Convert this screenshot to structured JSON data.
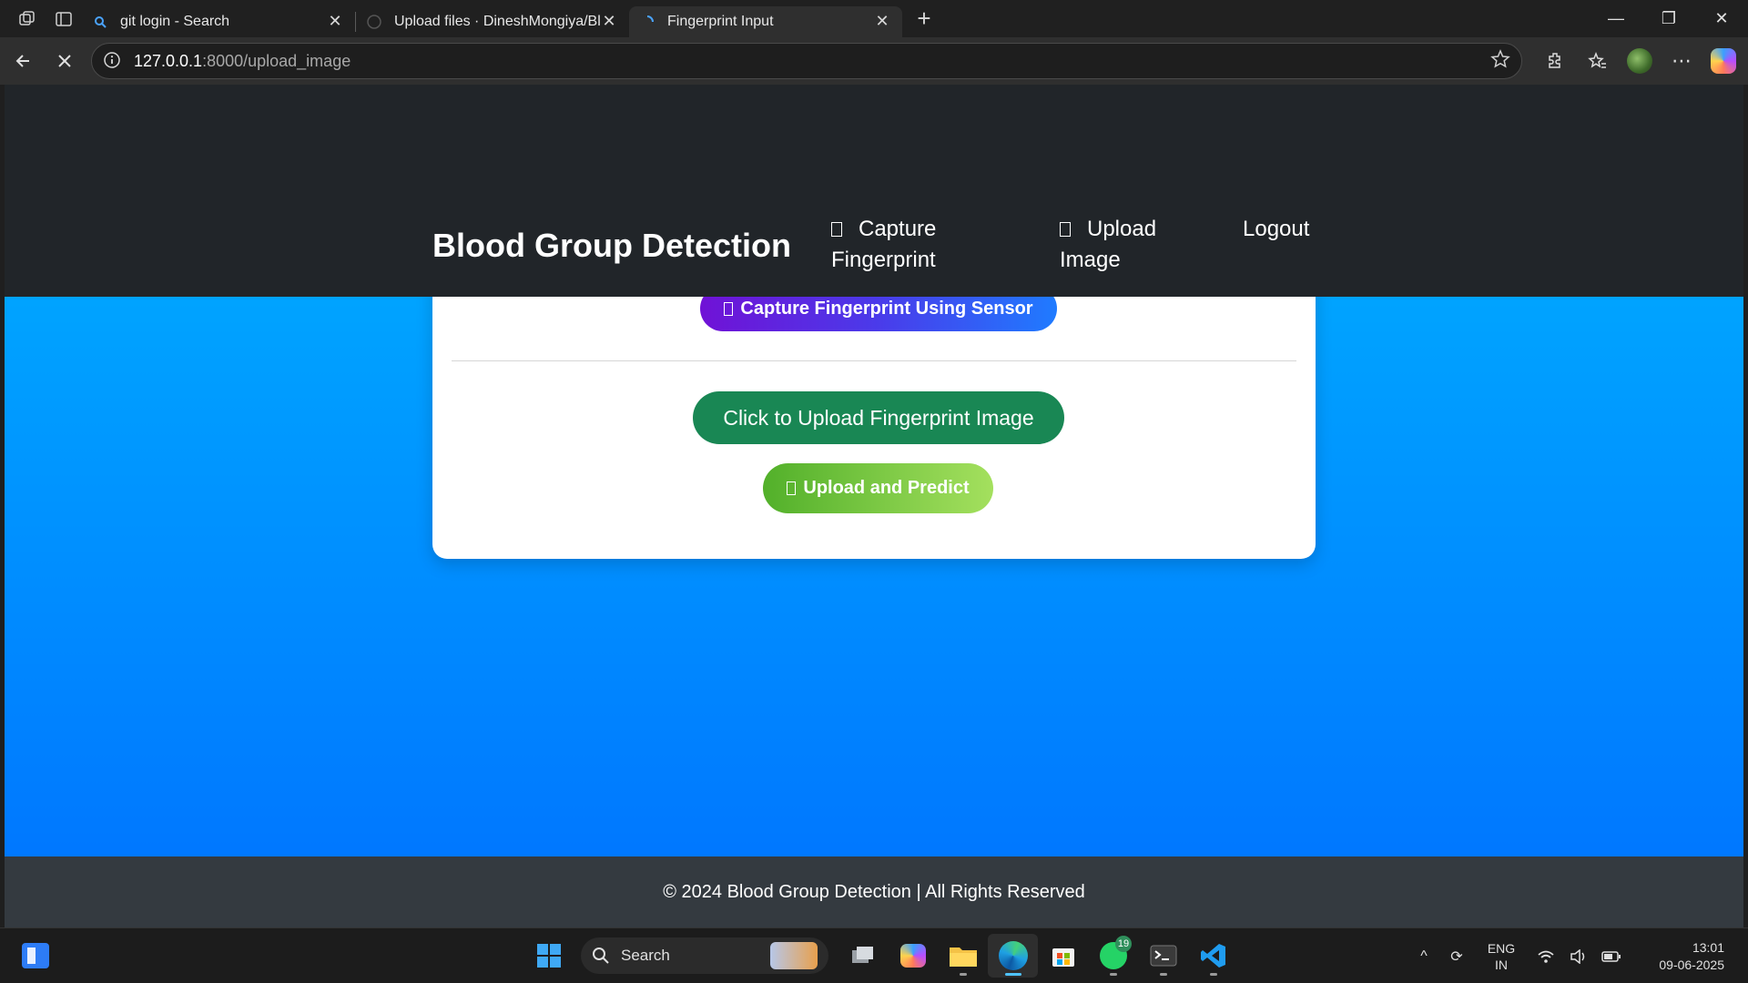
{
  "browser": {
    "tabs": [
      {
        "title": "git login - Search",
        "active": false,
        "icon": "search-icon"
      },
      {
        "title": "Upload files · DineshMongiya/Blo",
        "active": false,
        "icon": "github-icon"
      },
      {
        "title": "Fingerprint Input",
        "active": true,
        "icon": "loading-icon"
      }
    ],
    "address": {
      "host": "127.0.0.1",
      "path": ":8000/upload_image"
    }
  },
  "page": {
    "brand": "Blood Group Detection",
    "nav": {
      "capture_line1": "Capture",
      "capture_line2": "Fingerprint",
      "upload_line1": "Upload",
      "upload_line2": "Image",
      "logout": "Logout"
    },
    "card": {
      "capture_button": "Capture Fingerprint Using Sensor",
      "upload_pick_button": "Click to Upload Fingerprint Image",
      "predict_button": "Upload and Predict"
    },
    "footer": "© 2024 Blood Group Detection | All Rights Reserved",
    "colors": {
      "navbar": "#212529",
      "footer": "#343a40",
      "gradient_top": "#00b4ff",
      "gradient_bottom": "#0072ff",
      "upload_button": "#198754"
    }
  },
  "taskbar": {
    "search_label": "Search",
    "whatsapp_badge": "19",
    "lang_line1": "ENG",
    "lang_line2": "IN",
    "time": "13:01",
    "date": "09-06-2025"
  }
}
